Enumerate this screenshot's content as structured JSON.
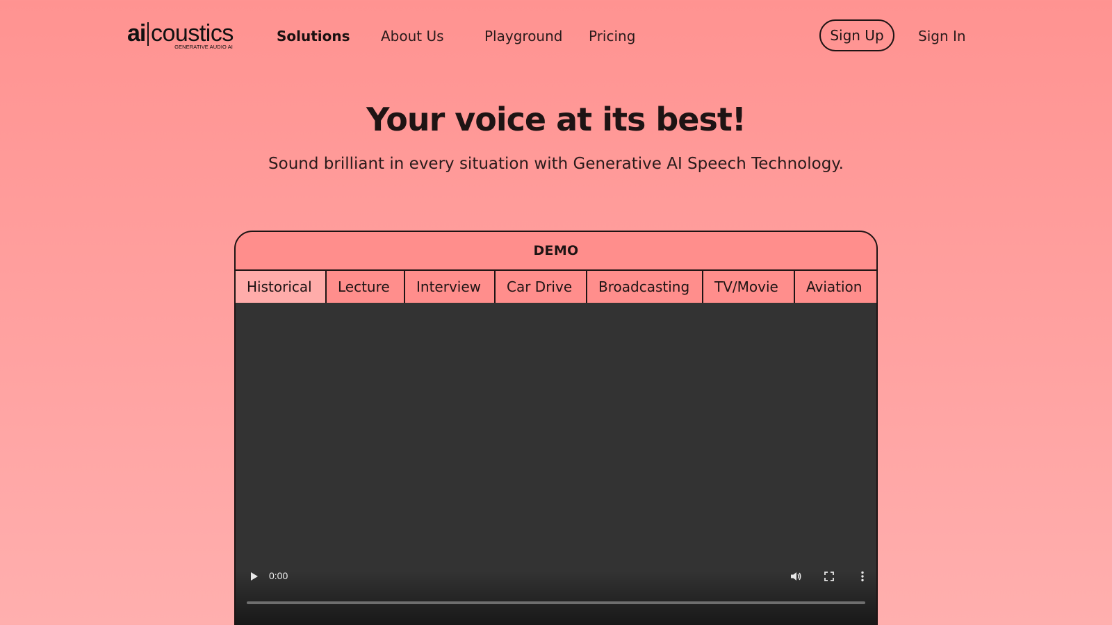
{
  "nav": {
    "logo_ai": "ai",
    "logo_rest": "coustics",
    "logo_tagline": "GENERATIVE AUDIO AI",
    "links": [
      {
        "label": "Solutions",
        "active": true
      },
      {
        "label": "About Us",
        "active": false
      },
      {
        "label": "Playground",
        "active": false
      },
      {
        "label": "Pricing",
        "active": false
      }
    ],
    "signup_label": "Sign Up",
    "signin_label": "Sign In"
  },
  "hero": {
    "title": "Your voice at its best!",
    "subtitle": "Sound brilliant in every situation with Generative AI Speech Technology."
  },
  "demo": {
    "header": "DEMO",
    "tabs": [
      "Historical",
      "Lecture",
      "Interview",
      "Car Drive",
      "Broadcasting",
      "TV/Movie",
      "Aviation"
    ],
    "selected_tab": "Historical",
    "video": {
      "time": "0:00",
      "progress_percent": 0
    }
  },
  "colors": {
    "background_top": "#ff9391",
    "background_bottom": "#ffafae",
    "ink": "#1e1414",
    "tab_selected": "#ffacaa",
    "video_bg": "#333333"
  }
}
